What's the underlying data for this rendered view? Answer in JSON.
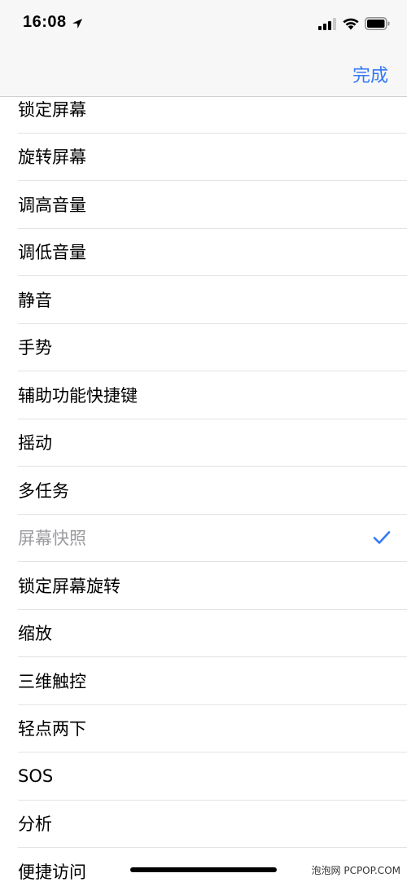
{
  "status_bar": {
    "time": "16:08",
    "icons": [
      "location-arrow-icon",
      "cellular-signal-icon",
      "wifi-icon",
      "battery-icon"
    ]
  },
  "nav": {
    "done_label": "完成"
  },
  "accent_color": "#3478f6",
  "list": {
    "items": [
      {
        "label": "锁定屏幕",
        "selected": false
      },
      {
        "label": "旋转屏幕",
        "selected": false
      },
      {
        "label": "调高音量",
        "selected": false
      },
      {
        "label": "调低音量",
        "selected": false
      },
      {
        "label": "静音",
        "selected": false
      },
      {
        "label": "手势",
        "selected": false
      },
      {
        "label": "辅助功能快捷键",
        "selected": false
      },
      {
        "label": "摇动",
        "selected": false
      },
      {
        "label": "多任务",
        "selected": false
      },
      {
        "label": "屏幕快照",
        "selected": true
      },
      {
        "label": "锁定屏幕旋转",
        "selected": false
      },
      {
        "label": "缩放",
        "selected": false
      },
      {
        "label": "三维触控",
        "selected": false
      },
      {
        "label": "轻点两下",
        "selected": false
      },
      {
        "label": "SOS",
        "selected": false
      },
      {
        "label": "分析",
        "selected": false
      },
      {
        "label": "便捷访问",
        "selected": false
      }
    ]
  },
  "watermark": "泡泡网 PCPOP.COM"
}
